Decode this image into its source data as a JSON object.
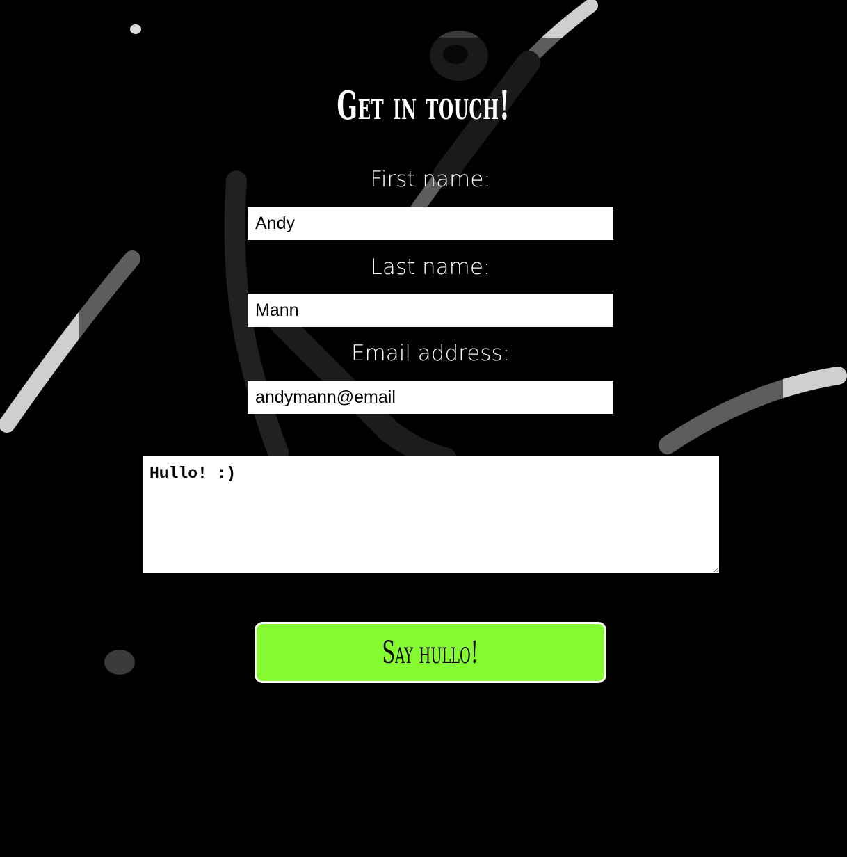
{
  "form": {
    "heading": "Get in touch!",
    "first_name": {
      "label": "First name:",
      "value": "Andy"
    },
    "last_name": {
      "label": "Last name:",
      "value": "Mann"
    },
    "email": {
      "label": "Email address:",
      "value": "andymann@email"
    },
    "message": {
      "value": "Hullo! :)"
    },
    "submit_label": "Say hullo!"
  },
  "colors": {
    "background": "#000000",
    "button": "#86fa31",
    "input_background": "#ffffff",
    "brush_strokes": "#5a5a5a"
  }
}
